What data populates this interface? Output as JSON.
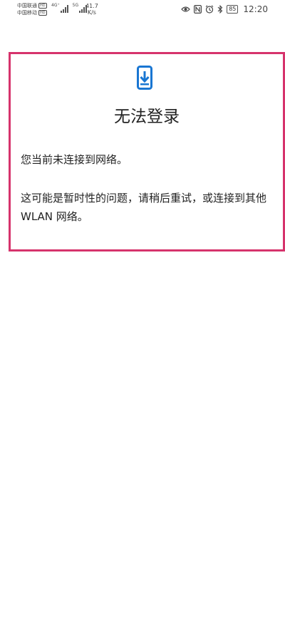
{
  "status_bar": {
    "carrier1": "中国联通",
    "carrier2": "中国移动",
    "hd_badge": "HD",
    "net1": "4G⁺",
    "net2": "5G",
    "speed_value": "41.7",
    "speed_unit": "K/s",
    "battery": "85",
    "time": "12:20",
    "icons": [
      "eye-icon",
      "nfc-icon",
      "alarm-icon",
      "bluetooth-icon",
      "battery-icon"
    ]
  },
  "dialog": {
    "icon": "phone-download-icon",
    "title": "无法登录",
    "message1": "您当前未连接到网络。",
    "message2": "这可能是暂时性的问题，请稍后重试，或连接到其他 WLAN 网络。",
    "accent_color": "#1976d2",
    "border_color": "#d6336c"
  }
}
